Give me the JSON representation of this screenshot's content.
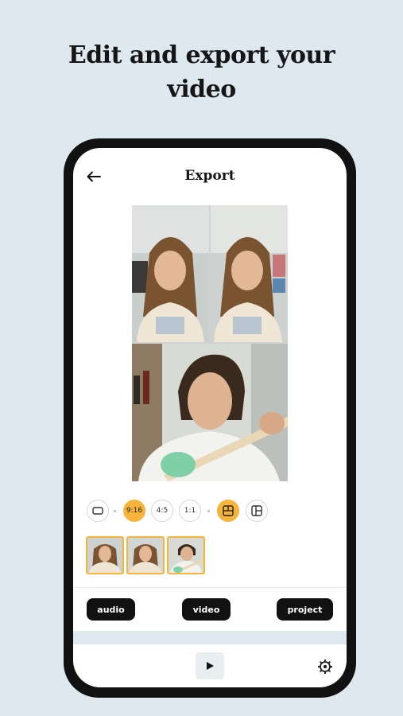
{
  "headline": {
    "line1": "Edit and export your",
    "line2": "video"
  },
  "header": {
    "title": "Export",
    "back_icon": "arrow-left-icon"
  },
  "aspect_ratios": [
    {
      "label": "",
      "icon": "landscape-rect-icon",
      "selected": false
    },
    {
      "label": "9:16",
      "selected": true
    },
    {
      "label": "4:5",
      "selected": false
    },
    {
      "label": "1:1",
      "selected": false
    }
  ],
  "layouts": [
    {
      "icon": "layout-stacked-icon",
      "selected": true
    },
    {
      "icon": "layout-grid-icon",
      "selected": false
    }
  ],
  "clips": [
    {
      "icon": "clip-thumbnail-woman"
    },
    {
      "icon": "clip-thumbnail-woman"
    },
    {
      "icon": "clip-thumbnail-guitarist"
    }
  ],
  "export_buttons": {
    "audio": "audio",
    "video": "video",
    "project": "project"
  },
  "footer": {
    "play_icon": "play-icon",
    "settings_icon": "gear-icon"
  },
  "colors": {
    "accent": "#f6b53a",
    "background": "#dde9ef",
    "dark": "#111111"
  }
}
